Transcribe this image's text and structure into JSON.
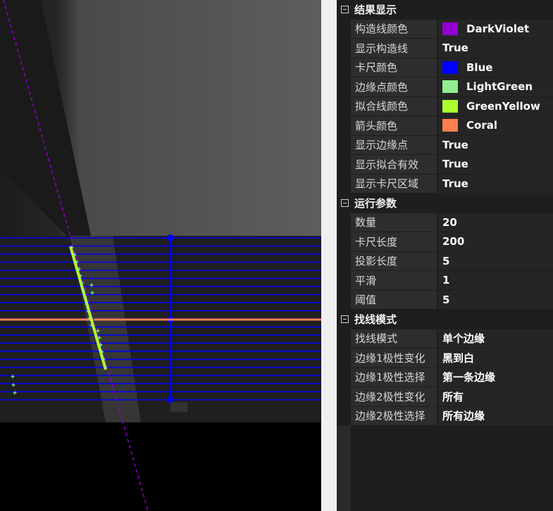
{
  "image_viewer": {
    "overlay_colors": {
      "construction_line": "#9400D3",
      "caliper": "#0000FF",
      "edge_points": "#90EE90",
      "fit_line": "#ADFF2F",
      "arrow": "#FF7F50"
    }
  },
  "property_grid": {
    "sections": [
      {
        "title": "结果显示",
        "rows": [
          {
            "name": "构造线颜色",
            "value": "DarkViolet",
            "swatch": "#9400D3"
          },
          {
            "name": "显示构造线",
            "value": "True"
          },
          {
            "name": "卡尺颜色",
            "value": "Blue",
            "swatch": "#0000FF"
          },
          {
            "name": "边缘点颜色",
            "value": "LightGreen",
            "swatch": "#90EE90"
          },
          {
            "name": "拟合线颜色",
            "value": "GreenYellow",
            "swatch": "#ADFF2F"
          },
          {
            "name": "箭头颜色",
            "value": "Coral",
            "swatch": "#FF7F50"
          },
          {
            "name": "显示边缘点",
            "value": "True"
          },
          {
            "name": "显示拟合有效",
            "value": "True"
          },
          {
            "name": "显示卡尺区域",
            "value": "True"
          }
        ]
      },
      {
        "title": "运行参数",
        "rows": [
          {
            "name": "数量",
            "value": "20"
          },
          {
            "name": "卡尺长度",
            "value": "200"
          },
          {
            "name": "投影长度",
            "value": "5"
          },
          {
            "name": "平滑",
            "value": "1"
          },
          {
            "name": "阈值",
            "value": "5"
          }
        ]
      },
      {
        "title": "找线模式",
        "rows": [
          {
            "name": "找线模式",
            "value": "单个边缘"
          },
          {
            "name": "边缘1极性变化",
            "value": "黑到白"
          },
          {
            "name": "边缘1极性选择",
            "value": "第一条边缘"
          },
          {
            "name": "边缘2极性变化",
            "value": "所有"
          },
          {
            "name": "边缘2极性选择",
            "value": "所有边缘"
          }
        ]
      }
    ]
  }
}
